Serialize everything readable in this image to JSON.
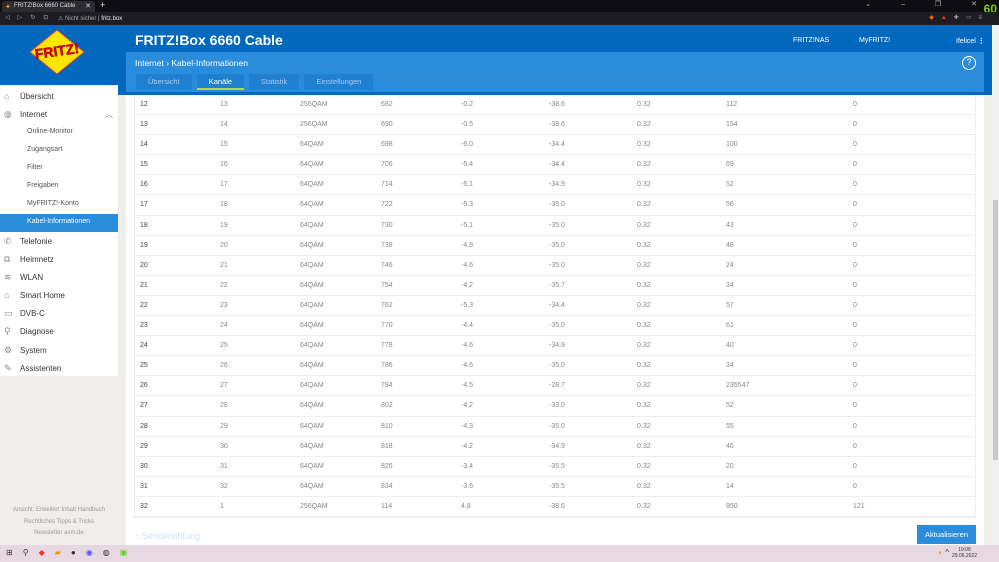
{
  "browser": {
    "tab_title": "FRITZ!Box 6660 Cable",
    "security": "Nicht sicher",
    "url": "fritz.box",
    "fps": "60"
  },
  "header": {
    "logo": "FRITZ!",
    "title": "FRITZ!Box 6660 Cable",
    "links": [
      "FRITZ!NAS",
      "MyFRITZ!",
      "Ifelicel"
    ],
    "breadcrumb": [
      "Internet",
      "Kabel-Informationen"
    ],
    "help": "?"
  },
  "tabs": [
    {
      "label": "Übersicht",
      "active": false
    },
    {
      "label": "Kanäle",
      "active": true
    },
    {
      "label": "Statistik",
      "active": false
    },
    {
      "label": "Einstellungen",
      "active": false
    }
  ],
  "sidebar": {
    "items": [
      {
        "label": "Übersicht",
        "icon": "home-icon",
        "type": "main"
      },
      {
        "label": "Internet",
        "icon": "globe-icon",
        "type": "main",
        "expanded": true
      },
      {
        "label": "Online-Monitor",
        "type": "sub"
      },
      {
        "label": "Zugangsart",
        "type": "sub"
      },
      {
        "label": "Filter",
        "type": "sub"
      },
      {
        "label": "Freigaben",
        "type": "sub"
      },
      {
        "label": "MyFRITZ!-Konto",
        "type": "sub"
      },
      {
        "label": "Kabel-Informationen",
        "type": "sub",
        "selected": true
      },
      {
        "label": "Telefonie",
        "icon": "phone-icon",
        "type": "main"
      },
      {
        "label": "Heimnetz",
        "icon": "network-icon",
        "type": "main"
      },
      {
        "label": "WLAN",
        "icon": "wifi-icon",
        "type": "main"
      },
      {
        "label": "Smart Home",
        "icon": "smarthome-icon",
        "type": "main"
      },
      {
        "label": "DVB-C",
        "icon": "tv-icon",
        "type": "main"
      },
      {
        "label": "Diagnose",
        "icon": "diagnose-icon",
        "type": "main"
      },
      {
        "label": "System",
        "icon": "system-icon",
        "type": "main"
      },
      {
        "label": "Assistenten",
        "icon": "wizard-icon",
        "type": "main"
      }
    ],
    "footer": [
      "Ansicht: Erweitert",
      "Inhalt",
      "Handbuch",
      "Rechtliches",
      "Tipps & Tricks",
      "Newsletter",
      "avm.de"
    ]
  },
  "table": {
    "rows": [
      [
        "12",
        "13",
        "256QAM",
        "682",
        "-0.2",
        "-38.6",
        "0.32",
        "112",
        "0"
      ],
      [
        "13",
        "14",
        "256QAM",
        "690",
        "-0.5",
        "-38.6",
        "0.32",
        "154",
        "0"
      ],
      [
        "14",
        "15",
        "64QAM",
        "698",
        "-6.0",
        "-34.4",
        "0.32",
        "100",
        "0"
      ],
      [
        "15",
        "16",
        "64QAM",
        "706",
        "-5.4",
        "-34.4",
        "0.32",
        "69",
        "0"
      ],
      [
        "16",
        "17",
        "64QAM",
        "714",
        "-5.1",
        "-34.9",
        "0.32",
        "52",
        "0"
      ],
      [
        "17",
        "18",
        "64QAM",
        "722",
        "-5.3",
        "-35.0",
        "0.32",
        "56",
        "0"
      ],
      [
        "18",
        "19",
        "64QAM",
        "730",
        "-5.1",
        "-35.0",
        "0.32",
        "43",
        "0"
      ],
      [
        "19",
        "20",
        "64QAM",
        "738",
        "-4.8",
        "-35.0",
        "0.32",
        "48",
        "0"
      ],
      [
        "20",
        "21",
        "64QAM",
        "746",
        "-4.6",
        "-35.0",
        "0.32",
        "24",
        "0"
      ],
      [
        "21",
        "22",
        "64QAM",
        "754",
        "-4.2",
        "-35.7",
        "0.32",
        "34",
        "0"
      ],
      [
        "22",
        "23",
        "64QAM",
        "762",
        "-5.3",
        "-34.4",
        "0.32",
        "57",
        "0"
      ],
      [
        "23",
        "24",
        "64QAM",
        "770",
        "-4.4",
        "-35.0",
        "0.32",
        "61",
        "0"
      ],
      [
        "24",
        "25",
        "64QAM",
        "778",
        "-4.6",
        "-34.9",
        "0.32",
        "40",
        "0"
      ],
      [
        "25",
        "26",
        "64QAM",
        "786",
        "-4.6",
        "-35.0",
        "0.32",
        "34",
        "0"
      ],
      [
        "26",
        "27",
        "64QAM",
        "794",
        "-4.5",
        "-28.7",
        "0.32",
        "235547",
        "0"
      ],
      [
        "27",
        "28",
        "64QAM",
        "802",
        "-4.2",
        "-33.0",
        "0.32",
        "52",
        "0"
      ],
      [
        "28",
        "29",
        "64QAM",
        "810",
        "-4.3",
        "-35.0",
        "0.32",
        "55",
        "0"
      ],
      [
        "29",
        "30",
        "64QAM",
        "818",
        "-4.2",
        "-34.9",
        "0.32",
        "46",
        "0"
      ],
      [
        "30",
        "31",
        "64QAM",
        "826",
        "-3.4",
        "-35.5",
        "0.32",
        "20",
        "0"
      ],
      [
        "31",
        "32",
        "64QAM",
        "834",
        "-3.6",
        "-35.5",
        "0.32",
        "14",
        "0"
      ],
      [
        "32",
        "1",
        "256QAM",
        "114",
        "4.8",
        "-38.6",
        "0.32",
        "950",
        "121"
      ]
    ]
  },
  "bottom": {
    "section": "↑ Senderichtung",
    "refresh": "Aktualisieren"
  },
  "taskbar": {
    "time": "19:08",
    "date": "29.06.2022"
  }
}
